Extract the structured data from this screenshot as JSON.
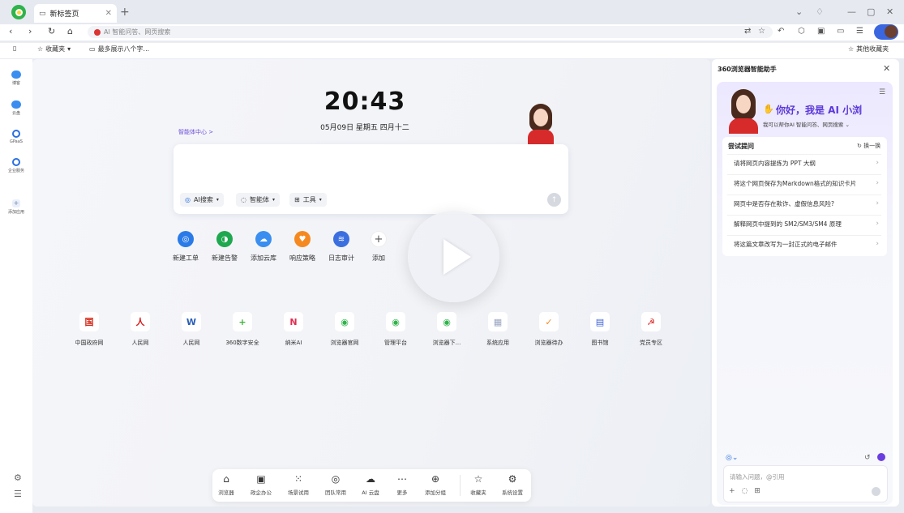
{
  "tab": {
    "title": "新标签页"
  },
  "address": {
    "placeholder": "AI 智能问答、网页搜索"
  },
  "bookmarks": {
    "favorites": "收藏夹",
    "folder": "最多展示八个字...",
    "other": "其他收藏夹"
  },
  "sidebar": {
    "items": [
      {
        "label": "博客",
        "icon": "cloud-icon"
      },
      {
        "label": "云盘",
        "icon": "cloud-drive-icon"
      },
      {
        "label": "GPaaS",
        "icon": "circle-icon"
      },
      {
        "label": "企业服务",
        "icon": "service-icon"
      },
      {
        "label": "添加应用",
        "icon": "plus-icon"
      }
    ]
  },
  "main": {
    "time": "20:43",
    "date": "05月09日 星期五 四月十二",
    "agent_center": "智能体中心 >",
    "chips": {
      "ai_search": "AI搜索",
      "agent": "智能体",
      "tools": "工具"
    },
    "quick_actions": [
      {
        "label": "新建工单",
        "color": "#2a7be8"
      },
      {
        "label": "新建告警",
        "color": "#1fa84f"
      },
      {
        "label": "添加云库",
        "color": "#3a8ef0"
      },
      {
        "label": "响应策略",
        "color": "#f5891f"
      },
      {
        "label": "日志审计",
        "color": "#3b6fe0"
      },
      {
        "label": "添加",
        "color": "#ffffff"
      }
    ],
    "sites": [
      {
        "label": "中国政府网",
        "glyph": "国",
        "color": "#d32a1a"
      },
      {
        "label": "人民网",
        "glyph": "人",
        "color": "#d81e1e"
      },
      {
        "label": "人民网",
        "glyph": "W",
        "color": "#2a5fb8"
      },
      {
        "label": "360数字安全",
        "glyph": "+",
        "color": "#3fb23a"
      },
      {
        "label": "纳米AI",
        "glyph": "N",
        "color": "#e02d4f"
      },
      {
        "label": "浏览器官网",
        "glyph": "◉",
        "color": "#2fb34a"
      },
      {
        "label": "管理平台",
        "glyph": "◉",
        "color": "#2fb34a"
      },
      {
        "label": "浏览器下...",
        "glyph": "◉",
        "color": "#2fb34a"
      },
      {
        "label": "系统应用",
        "glyph": "▦",
        "color": "#9aa6c0"
      },
      {
        "label": "浏览器待办",
        "glyph": "✓",
        "color": "#f58a1f"
      },
      {
        "label": "图书馆",
        "glyph": "▤",
        "color": "#3a5fd6"
      },
      {
        "label": "党员专区",
        "glyph": "☭",
        "color": "#d81e1e"
      }
    ],
    "dock": [
      {
        "label": "浏览器",
        "glyph": "⌂"
      },
      {
        "label": "政企办公",
        "glyph": "▣"
      },
      {
        "label": "场景试用",
        "glyph": "⁙"
      },
      {
        "label": "团队常用",
        "glyph": "◎"
      },
      {
        "label": "AI 云盘",
        "glyph": "☁"
      },
      {
        "label": "更多",
        "glyph": "⋯"
      },
      {
        "label": "添加分组",
        "glyph": "⊕"
      },
      {
        "label": "收藏夹",
        "glyph": "☆"
      },
      {
        "label": "系统设置",
        "glyph": "⚙"
      }
    ]
  },
  "assistant": {
    "title": "360浏览器智能助手",
    "greeting": "你好，我是 AI 小浏",
    "subtitle": "我可以帮你AI 智能问答、网页搜索 ⌄",
    "try_title": "尝试提问",
    "swap": "换一换",
    "questions": [
      "请将网页内容提炼为 PPT 大纲",
      "将这个网页保存为Markdown格式的知识卡片",
      "网页中是否存在欺诈、虚假信息风险?",
      "解释网页中提到的 SM2/SM3/SM4 原理",
      "将这篇文章改写为一封正式的电子邮件"
    ],
    "input_placeholder": "请输入问题，@引用"
  }
}
